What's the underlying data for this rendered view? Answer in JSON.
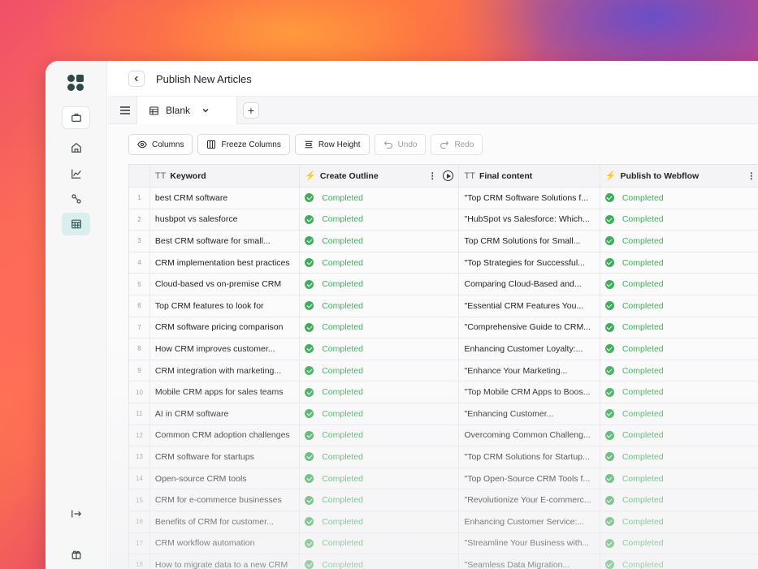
{
  "app": {
    "page_title": "Publish New Articles"
  },
  "tabs": {
    "active_label": "Blank",
    "add_label": "+"
  },
  "toolbar": {
    "columns": "Columns",
    "freeze": "Freeze Columns",
    "row_height": "Row Height",
    "undo": "Undo",
    "redo": "Redo"
  },
  "table": {
    "headers": {
      "keyword": "Keyword",
      "outline": "Create Outline",
      "final": "Final content",
      "publish": "Publish to Webflow"
    },
    "rows": [
      {
        "n": "1",
        "keyword": "best CRM software",
        "outline": "Completed",
        "final": "\"Top CRM Software Solutions f...",
        "publish": "Completed"
      },
      {
        "n": "2",
        "keyword": "husbpot vs salesforce",
        "outline": "Completed",
        "final": "\"HubSpot vs Salesforce: Which...",
        "publish": "Completed"
      },
      {
        "n": "3",
        "keyword": "Best CRM software for small...",
        "outline": "Completed",
        "final": "Top CRM Solutions for Small...",
        "publish": "Completed"
      },
      {
        "n": "4",
        "keyword": "CRM implementation best practices",
        "outline": "Completed",
        "final": "\"Top Strategies for Successful...",
        "publish": "Completed"
      },
      {
        "n": "5",
        "keyword": "Cloud-based vs on-premise CRM",
        "outline": "Completed",
        "final": "Comparing Cloud-Based and...",
        "publish": "Completed"
      },
      {
        "n": "6",
        "keyword": "Top CRM features to look for",
        "outline": "Completed",
        "final": "\"Essential CRM Features You...",
        "publish": "Completed"
      },
      {
        "n": "7",
        "keyword": "CRM software pricing comparison",
        "outline": "Completed",
        "final": "\"Comprehensive Guide to CRM...",
        "publish": "Completed"
      },
      {
        "n": "8",
        "keyword": "How CRM improves customer...",
        "outline": "Completed",
        "final": "Enhancing Customer Loyalty:...",
        "publish": "Completed"
      },
      {
        "n": "9",
        "keyword": "CRM integration with marketing...",
        "outline": "Completed",
        "final": "\"Enhance Your Marketing...",
        "publish": "Completed"
      },
      {
        "n": "10",
        "keyword": "Mobile CRM apps for sales teams",
        "outline": "Completed",
        "final": "\"Top Mobile CRM Apps to Boos...",
        "publish": "Completed"
      },
      {
        "n": "11",
        "keyword": "AI in CRM software",
        "outline": "Completed",
        "final": "\"Enhancing Customer...",
        "publish": "Completed"
      },
      {
        "n": "12",
        "keyword": "Common CRM adoption challenges",
        "outline": "Completed",
        "final": "Overcoming Common Challeng...",
        "publish": "Completed"
      },
      {
        "n": "13",
        "keyword": "CRM software for startups",
        "outline": "Completed",
        "final": "\"Top CRM Solutions for Startup...",
        "publish": "Completed"
      },
      {
        "n": "14",
        "keyword": "Open-source CRM tools",
        "outline": "Completed",
        "final": "\"Top Open-Source CRM Tools f...",
        "publish": "Completed"
      },
      {
        "n": "15",
        "keyword": "CRM for e-commerce businesses",
        "outline": "Completed",
        "final": "\"Revolutionize Your E-commerc...",
        "publish": "Completed"
      },
      {
        "n": "16",
        "keyword": "Benefits of CRM for customer...",
        "outline": "Completed",
        "final": "Enhancing Customer Service:...",
        "publish": "Completed"
      },
      {
        "n": "17",
        "keyword": "CRM workflow automation",
        "outline": "Completed",
        "final": "\"Streamline Your Business with...",
        "publish": "Completed"
      },
      {
        "n": "18",
        "keyword": "How to migrate data to a new CRM",
        "outline": "Completed",
        "final": "\"Seamless Data Migration...",
        "publish": "Completed"
      }
    ]
  },
  "colors": {
    "status_green": "#3fae5a",
    "sidebar_active": "#dbeeee"
  }
}
